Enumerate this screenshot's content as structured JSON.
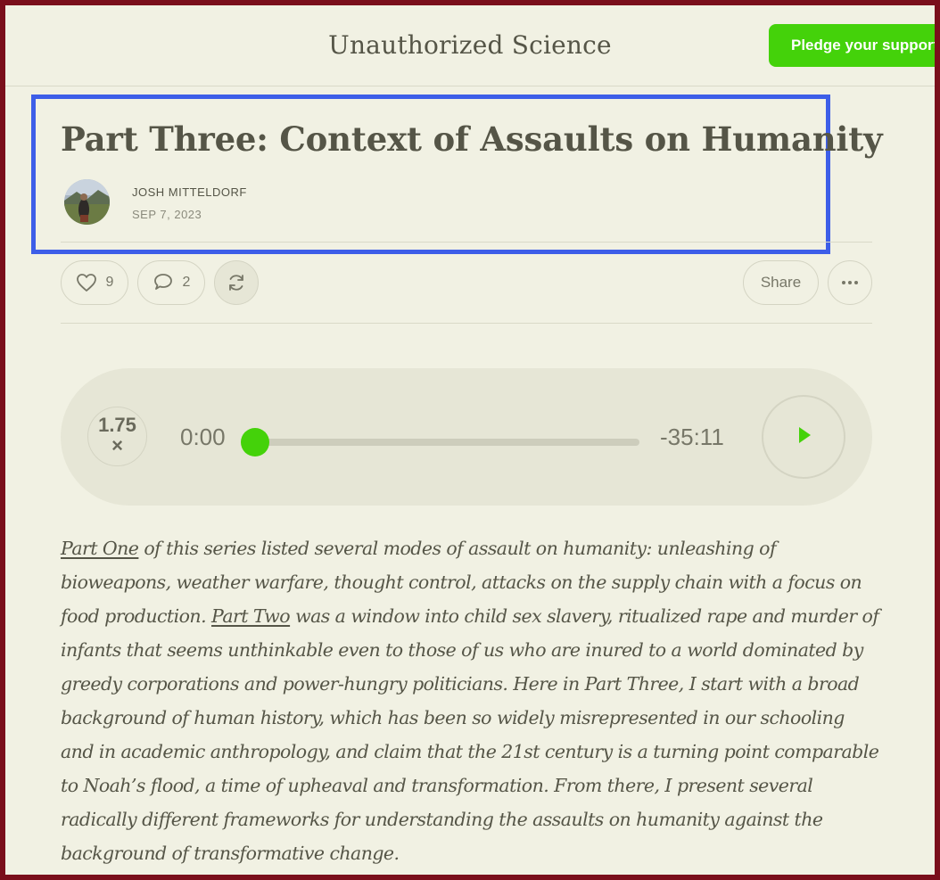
{
  "header": {
    "site_title": "Unauthorized Science",
    "pledge_label": "Pledge your support"
  },
  "post": {
    "title": "Part Three: Context of Assaults on Humanity",
    "author": "JOSH MITTELDORF",
    "date": "SEP 7, 2023"
  },
  "actions": {
    "likes": "9",
    "comments": "2",
    "share_label": "Share"
  },
  "player": {
    "speed": "1.75",
    "speed_suffix": "×",
    "current_time": "0:00",
    "remaining_time": "-35:11",
    "progress": 0
  },
  "body": {
    "link_part_one": "Part One",
    "text_1": " of this series listed several modes of assault on humanity: unleashing of bioweapons, weather warfare, thought control, attacks on the supply chain with a focus on food production. ",
    "link_part_two": "Part Two",
    "text_2": " was a window into child sex slavery, ritualized rape and murder of infants that seems unthinkable even to those of us who are inured to a world dominated by greedy corporations and power-hungry politicians. Here in Part Three, I start with a broad background of human history, which has been so widely misrepresented in our schooling and in academic anthropology, and claim that the 21st century is a turning point comparable to Noah’s flood, a time of upheaval and transformation. From there, I present several radically different frameworks for understanding the assaults on humanity against the background of transformative change."
  },
  "colors": {
    "accent": "#44d20a",
    "highlight": "#3d5ee8",
    "frame": "#7a0f1b",
    "background": "#f1f1e3"
  }
}
